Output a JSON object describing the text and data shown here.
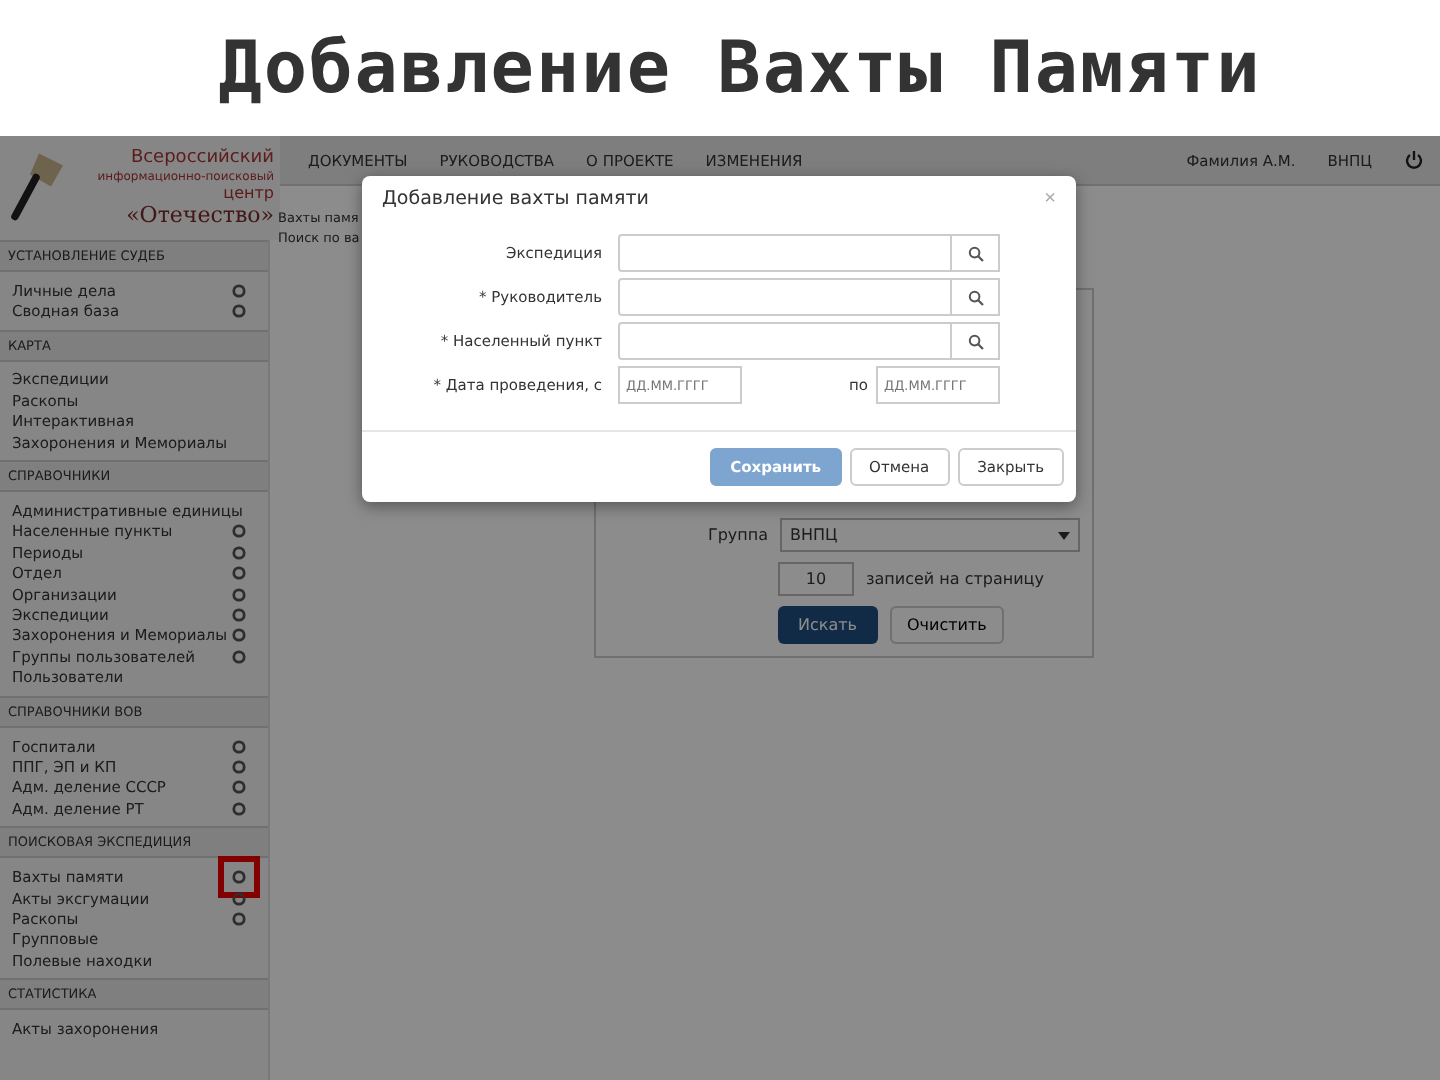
{
  "slide_title": "Добавление Вахты Памяти",
  "logo": {
    "lines": [
      "Всероссийский",
      "информационно-поисковый",
      "центр",
      "«Отечество»"
    ]
  },
  "nav_items": [
    "ДОКУМЕНТЫ",
    "РУКОВОДСТВА",
    "О ПРОЕКТЕ",
    "ИЗМЕНЕНИЯ"
  ],
  "user": "Фамилия А.М.",
  "organization": "ВНПЦ",
  "sidebar": [
    {
      "heading": "УСТАНОВЛЕНИЕ СУДЕБ",
      "items": [
        {
          "label": "Личные дела",
          "settings": true,
          "highlighted": false
        },
        {
          "label": "Сводная база",
          "settings": true,
          "highlighted": false
        }
      ]
    },
    {
      "heading": "КАРТА",
      "items": [
        {
          "label": "Экспедиции",
          "settings": false
        },
        {
          "label": "Раскопы",
          "settings": false
        },
        {
          "label": "Интерактивная",
          "settings": false
        },
        {
          "label": "Захоронения и Мемориалы",
          "settings": false
        }
      ]
    },
    {
      "heading": "СПРАВОЧНИКИ",
      "items": [
        {
          "label": "Административные единицы",
          "settings": false
        },
        {
          "label": "Населенные пункты",
          "settings": true,
          "highlighted": false
        },
        {
          "label": "Периоды",
          "settings": true,
          "highlighted": false
        },
        {
          "label": "Отдел",
          "settings": true,
          "highlighted": false
        },
        {
          "label": "Организации",
          "settings": true,
          "highlighted": false
        },
        {
          "label": "Экспедиции",
          "settings": true,
          "highlighted": false
        },
        {
          "label": "Захоронения и Мемориалы",
          "settings": true,
          "highlighted": false
        },
        {
          "label": "Группы пользователей",
          "settings": true,
          "highlighted": false
        },
        {
          "label": "Пользователи",
          "settings": false
        }
      ]
    },
    {
      "heading": "СПРАВОЧНИКИ ВОВ",
      "items": [
        {
          "label": "Госпитали",
          "settings": true,
          "highlighted": false
        },
        {
          "label": "ППГ, ЭП и КП",
          "settings": true,
          "highlighted": false
        },
        {
          "label": "Адм. деление СССР",
          "settings": true,
          "highlighted": false
        },
        {
          "label": "Адм. деление РТ",
          "settings": true,
          "highlighted": false
        }
      ]
    },
    {
      "heading": "ПОИСКОВАЯ ЭКСПЕДИЦИЯ",
      "items": [
        {
          "label": "Вахты памяти",
          "settings": true,
          "highlighted": true
        },
        {
          "label": "Акты эксгумации",
          "settings": true,
          "highlighted": false
        },
        {
          "label": "Раскопы",
          "settings": true,
          "highlighted": false
        },
        {
          "label": "Групповые",
          "settings": false
        },
        {
          "label": "Полевые находки",
          "settings": false
        }
      ]
    },
    {
      "heading": "СТАТИСТИКА",
      "items": [
        {
          "label": "Акты захоронения",
          "settings": false
        }
      ]
    }
  ],
  "page": {
    "breadcrumb": "Вахты памя",
    "subtitle": "Поиск по ва",
    "group_label": "Группа",
    "group_value": "ВНПЦ",
    "per_page_value": "10",
    "per_page_label": "записей на страницу",
    "search_button": "Искать",
    "clear_button": "Очистить"
  },
  "modal": {
    "title": "Добавление вахты памяти",
    "close": "×",
    "fields": [
      {
        "kind": "lookup",
        "label": "Экспедиция"
      },
      {
        "kind": "lookup",
        "label": "* Руководитель"
      },
      {
        "kind": "lookup",
        "label": "* Населенный пункт"
      },
      {
        "kind": "date_range",
        "label": "* Дата проведения, с",
        "from_placeholder": "ДД.ММ.ГГГГ",
        "separator": "по",
        "to_placeholder": "ДД.ММ.ГГГГ"
      }
    ],
    "buttons": [
      {
        "kind": "primary",
        "label": "Сохранить"
      },
      {
        "kind": "default",
        "label": "Отмена"
      },
      {
        "kind": "default",
        "label": "Закрыть"
      }
    ]
  }
}
